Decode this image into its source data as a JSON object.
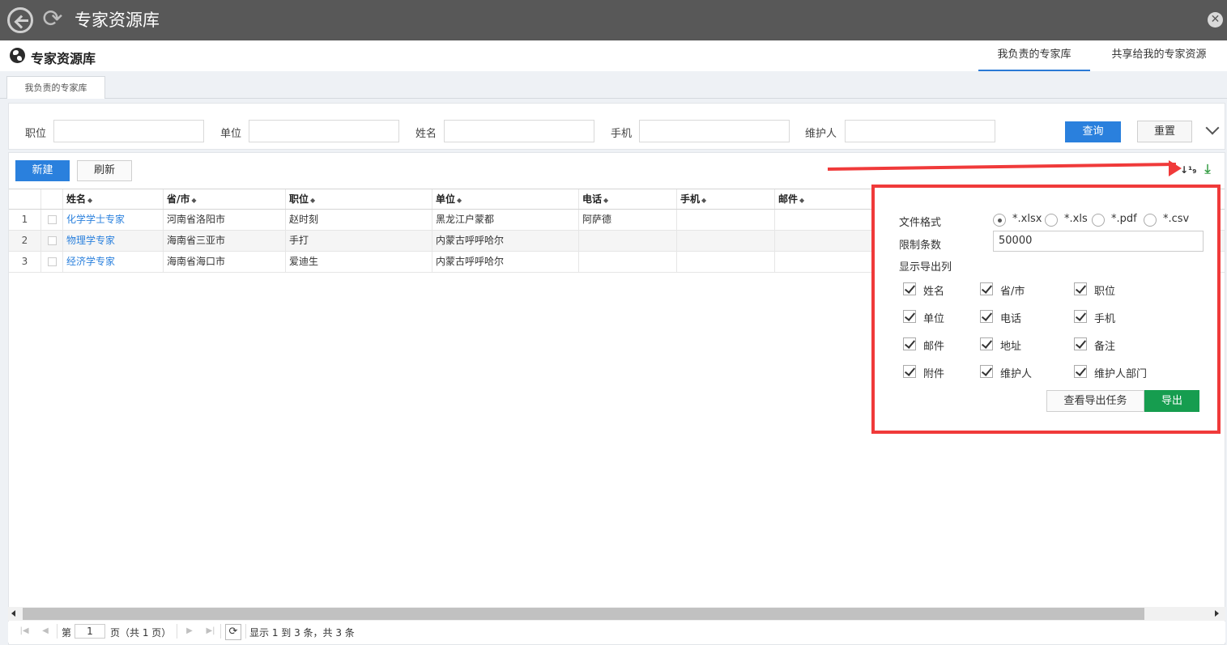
{
  "window": {
    "title": "专家资源库",
    "close_glyph": "✕",
    "refresh_glyph": "⟳"
  },
  "header": {
    "title": "专家资源库",
    "tabs": [
      {
        "label": "我负责的专家库",
        "active": true
      },
      {
        "label": "共享给我的专家资源",
        "active": false
      }
    ]
  },
  "subtab": {
    "label": "我负责的专家库"
  },
  "filters": {
    "fields": [
      {
        "label": "职位",
        "value": ""
      },
      {
        "label": "单位",
        "value": ""
      },
      {
        "label": "姓名",
        "value": ""
      },
      {
        "label": "手机",
        "value": ""
      },
      {
        "label": "维护人",
        "value": ""
      }
    ],
    "query_label": "查询",
    "reset_label": "重置"
  },
  "toolbar": {
    "new_label": "新建",
    "refresh_label": "刷新",
    "sort_icon_text": "↓¹₉",
    "download_glyph": "⤓"
  },
  "table": {
    "columns": [
      "姓名",
      "省/市",
      "职位",
      "单位",
      "电话",
      "手机",
      "邮件"
    ],
    "sort_glyph": "◆",
    "rows": [
      {
        "index": "1",
        "name": "化学学士专家",
        "city": "河南省洛阳市",
        "position": "赵时刻",
        "unit": "黑龙江户蒙都",
        "phone": "阿萨德",
        "mobile": "",
        "email": ""
      },
      {
        "index": "2",
        "name": "物理学专家",
        "city": "海南省三亚市",
        "position": "手打",
        "unit": "内蒙古呼呼哈尔",
        "phone": "",
        "mobile": "",
        "email": ""
      },
      {
        "index": "3",
        "name": "经济学专家",
        "city": "海南省海口市",
        "position": "爱迪生",
        "unit": "内蒙古呼呼哈尔",
        "phone": "",
        "mobile": "",
        "email": ""
      }
    ]
  },
  "export": {
    "format_label": "文件格式",
    "formats": [
      {
        "label": "*.xlsx",
        "selected": true
      },
      {
        "label": "*.xls",
        "selected": false
      },
      {
        "label": "*.pdf",
        "selected": false
      },
      {
        "label": "*.csv",
        "selected": false
      }
    ],
    "limit_label": "限制条数",
    "limit_value": "50000",
    "columns_label": "显示导出列",
    "columns": [
      {
        "label": "姓名",
        "checked": true
      },
      {
        "label": "省/市",
        "checked": true
      },
      {
        "label": "职位",
        "checked": true
      },
      {
        "label": "单位",
        "checked": true
      },
      {
        "label": "电话",
        "checked": true
      },
      {
        "label": "手机",
        "checked": true
      },
      {
        "label": "邮件",
        "checked": true
      },
      {
        "label": "地址",
        "checked": true
      },
      {
        "label": "备注",
        "checked": true
      },
      {
        "label": "附件",
        "checked": true
      },
      {
        "label": "维护人",
        "checked": true
      },
      {
        "label": "维护人部门",
        "checked": true
      }
    ],
    "view_tasks_label": "查看导出任务",
    "export_label": "导出"
  },
  "pager": {
    "page_prefix": "第",
    "page_value": "1",
    "page_suffix": "页（共 1 页）",
    "summary": "显示 1 到 3 条，共 3 条",
    "first_glyph": "|◀",
    "prev_glyph": "◀",
    "next_glyph": "▶",
    "last_glyph": "▶|",
    "reload_glyph": "⟳"
  },
  "colors": {
    "titlebar": "#585858",
    "primary": "#2a80dd",
    "export_button": "#169d4f",
    "highlight": "#f03a3a",
    "link": "#2a80dd"
  }
}
